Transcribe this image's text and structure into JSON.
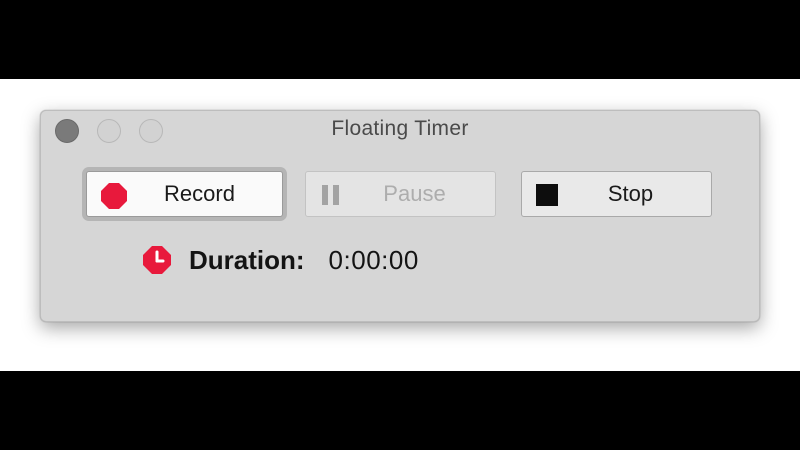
{
  "window": {
    "title": "Floating Timer"
  },
  "buttons": {
    "record_label": "Record",
    "pause_label": "Pause",
    "stop_label": "Stop",
    "pause_enabled": false
  },
  "duration": {
    "label": "Duration:",
    "value": "0:00:00"
  },
  "icons": {
    "record": "record-icon",
    "pause": "pause-icon",
    "stop": "stop-icon",
    "duration": "clock-icon"
  },
  "colors": {
    "accent_red": "#e8193c",
    "window_bg": "#d6d6d6",
    "disabled_text": "#adadad"
  }
}
